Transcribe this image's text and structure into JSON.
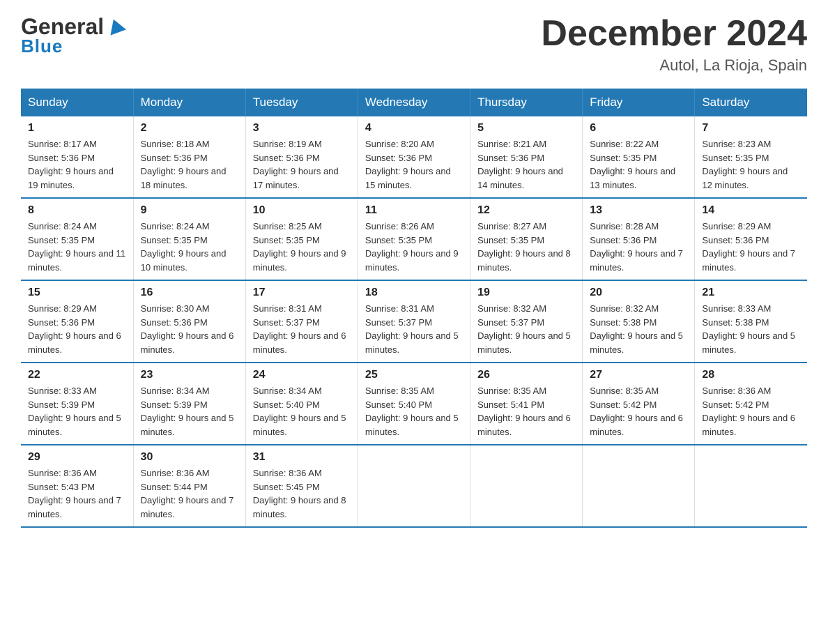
{
  "header": {
    "logo_general": "General",
    "logo_blue": "Blue",
    "title": "December 2024",
    "subtitle": "Autol, La Rioja, Spain"
  },
  "days_of_week": [
    "Sunday",
    "Monday",
    "Tuesday",
    "Wednesday",
    "Thursday",
    "Friday",
    "Saturday"
  ],
  "weeks": [
    [
      {
        "num": "1",
        "sunrise": "8:17 AM",
        "sunset": "5:36 PM",
        "daylight": "9 hours and 19 minutes."
      },
      {
        "num": "2",
        "sunrise": "8:18 AM",
        "sunset": "5:36 PM",
        "daylight": "9 hours and 18 minutes."
      },
      {
        "num": "3",
        "sunrise": "8:19 AM",
        "sunset": "5:36 PM",
        "daylight": "9 hours and 17 minutes."
      },
      {
        "num": "4",
        "sunrise": "8:20 AM",
        "sunset": "5:36 PM",
        "daylight": "9 hours and 15 minutes."
      },
      {
        "num": "5",
        "sunrise": "8:21 AM",
        "sunset": "5:36 PM",
        "daylight": "9 hours and 14 minutes."
      },
      {
        "num": "6",
        "sunrise": "8:22 AM",
        "sunset": "5:35 PM",
        "daylight": "9 hours and 13 minutes."
      },
      {
        "num": "7",
        "sunrise": "8:23 AM",
        "sunset": "5:35 PM",
        "daylight": "9 hours and 12 minutes."
      }
    ],
    [
      {
        "num": "8",
        "sunrise": "8:24 AM",
        "sunset": "5:35 PM",
        "daylight": "9 hours and 11 minutes."
      },
      {
        "num": "9",
        "sunrise": "8:24 AM",
        "sunset": "5:35 PM",
        "daylight": "9 hours and 10 minutes."
      },
      {
        "num": "10",
        "sunrise": "8:25 AM",
        "sunset": "5:35 PM",
        "daylight": "9 hours and 9 minutes."
      },
      {
        "num": "11",
        "sunrise": "8:26 AM",
        "sunset": "5:35 PM",
        "daylight": "9 hours and 9 minutes."
      },
      {
        "num": "12",
        "sunrise": "8:27 AM",
        "sunset": "5:35 PM",
        "daylight": "9 hours and 8 minutes."
      },
      {
        "num": "13",
        "sunrise": "8:28 AM",
        "sunset": "5:36 PM",
        "daylight": "9 hours and 7 minutes."
      },
      {
        "num": "14",
        "sunrise": "8:29 AM",
        "sunset": "5:36 PM",
        "daylight": "9 hours and 7 minutes."
      }
    ],
    [
      {
        "num": "15",
        "sunrise": "8:29 AM",
        "sunset": "5:36 PM",
        "daylight": "9 hours and 6 minutes."
      },
      {
        "num": "16",
        "sunrise": "8:30 AM",
        "sunset": "5:36 PM",
        "daylight": "9 hours and 6 minutes."
      },
      {
        "num": "17",
        "sunrise": "8:31 AM",
        "sunset": "5:37 PM",
        "daylight": "9 hours and 6 minutes."
      },
      {
        "num": "18",
        "sunrise": "8:31 AM",
        "sunset": "5:37 PM",
        "daylight": "9 hours and 5 minutes."
      },
      {
        "num": "19",
        "sunrise": "8:32 AM",
        "sunset": "5:37 PM",
        "daylight": "9 hours and 5 minutes."
      },
      {
        "num": "20",
        "sunrise": "8:32 AM",
        "sunset": "5:38 PM",
        "daylight": "9 hours and 5 minutes."
      },
      {
        "num": "21",
        "sunrise": "8:33 AM",
        "sunset": "5:38 PM",
        "daylight": "9 hours and 5 minutes."
      }
    ],
    [
      {
        "num": "22",
        "sunrise": "8:33 AM",
        "sunset": "5:39 PM",
        "daylight": "9 hours and 5 minutes."
      },
      {
        "num": "23",
        "sunrise": "8:34 AM",
        "sunset": "5:39 PM",
        "daylight": "9 hours and 5 minutes."
      },
      {
        "num": "24",
        "sunrise": "8:34 AM",
        "sunset": "5:40 PM",
        "daylight": "9 hours and 5 minutes."
      },
      {
        "num": "25",
        "sunrise": "8:35 AM",
        "sunset": "5:40 PM",
        "daylight": "9 hours and 5 minutes."
      },
      {
        "num": "26",
        "sunrise": "8:35 AM",
        "sunset": "5:41 PM",
        "daylight": "9 hours and 6 minutes."
      },
      {
        "num": "27",
        "sunrise": "8:35 AM",
        "sunset": "5:42 PM",
        "daylight": "9 hours and 6 minutes."
      },
      {
        "num": "28",
        "sunrise": "8:36 AM",
        "sunset": "5:42 PM",
        "daylight": "9 hours and 6 minutes."
      }
    ],
    [
      {
        "num": "29",
        "sunrise": "8:36 AM",
        "sunset": "5:43 PM",
        "daylight": "9 hours and 7 minutes."
      },
      {
        "num": "30",
        "sunrise": "8:36 AM",
        "sunset": "5:44 PM",
        "daylight": "9 hours and 7 minutes."
      },
      {
        "num": "31",
        "sunrise": "8:36 AM",
        "sunset": "5:45 PM",
        "daylight": "9 hours and 8 minutes."
      },
      null,
      null,
      null,
      null
    ]
  ],
  "labels": {
    "sunrise": "Sunrise:",
    "sunset": "Sunset:",
    "daylight": "Daylight:"
  }
}
